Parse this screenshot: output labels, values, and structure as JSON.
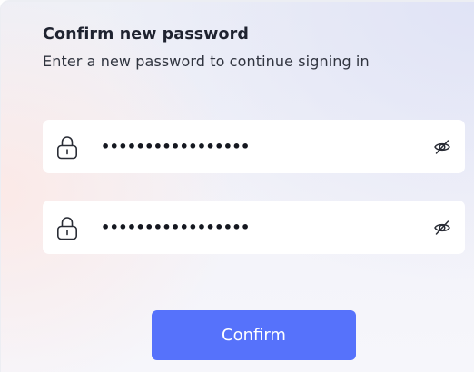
{
  "header": {
    "title": "Confirm new password",
    "subtitle": "Enter a new password to continue signing in"
  },
  "fields": [
    {
      "icon": "lock-icon",
      "value": "•••••••••••••••••",
      "toggle_icon": "eye-slash-icon"
    },
    {
      "icon": "lock-icon",
      "value": "•••••••••••••••••",
      "toggle_icon": "eye-slash-icon"
    }
  ],
  "actions": {
    "confirm_label": "Confirm"
  },
  "colors": {
    "accent": "#5672fb",
    "title_text": "#1f2330",
    "field_bg": "#ffffff"
  }
}
